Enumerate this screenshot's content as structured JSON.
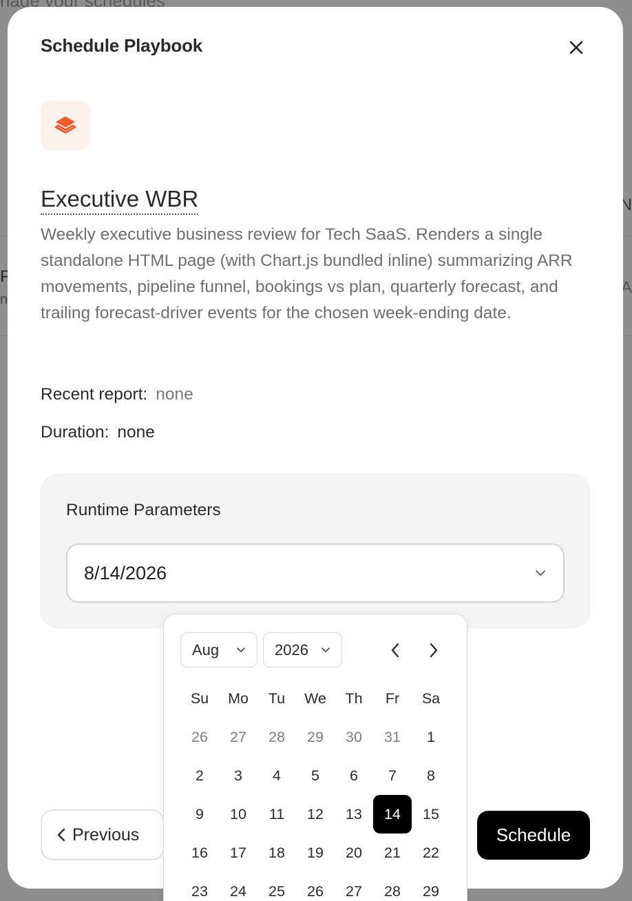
{
  "background": {
    "header_text": "nage your schedules",
    "left_glyphs": [
      "P",
      "n"
    ],
    "right_glyphs": [
      "N",
      "A"
    ]
  },
  "modal": {
    "title": "Schedule Playbook",
    "close_icon": "close-icon"
  },
  "playbook": {
    "icon": "layers-icon",
    "accent_color": "#f05a28",
    "name": "Executive WBR",
    "description": "Weekly executive business review for Tech SaaS. Renders a single standalone HTML page (with Chart.js bundled inline) summarizing ARR movements, pipeline funnel, bookings vs plan, quarterly forecast, and trailing forecast-driver events for the chosen week-ending date."
  },
  "meta": {
    "recent_report_label": "Recent report:",
    "recent_report_value": "none",
    "duration_label": "Duration:",
    "duration_value": "none"
  },
  "params": {
    "title": "Runtime Parameters",
    "date_value": "8/14/2026"
  },
  "calendar": {
    "month": "Aug",
    "year": "2026",
    "weekdays": [
      "Su",
      "Mo",
      "Tu",
      "We",
      "Th",
      "Fr",
      "Sa"
    ],
    "weeks": [
      [
        {
          "d": "26",
          "out": true
        },
        {
          "d": "27",
          "out": true
        },
        {
          "d": "28",
          "out": true
        },
        {
          "d": "29",
          "out": true
        },
        {
          "d": "30",
          "out": true
        },
        {
          "d": "31",
          "out": true
        },
        {
          "d": "1"
        }
      ],
      [
        {
          "d": "2"
        },
        {
          "d": "3"
        },
        {
          "d": "4"
        },
        {
          "d": "5"
        },
        {
          "d": "6"
        },
        {
          "d": "7"
        },
        {
          "d": "8"
        }
      ],
      [
        {
          "d": "9"
        },
        {
          "d": "10"
        },
        {
          "d": "11"
        },
        {
          "d": "12"
        },
        {
          "d": "13"
        },
        {
          "d": "14",
          "selected": true
        },
        {
          "d": "15"
        }
      ],
      [
        {
          "d": "16"
        },
        {
          "d": "17"
        },
        {
          "d": "18"
        },
        {
          "d": "19"
        },
        {
          "d": "20"
        },
        {
          "d": "21"
        },
        {
          "d": "22"
        }
      ],
      [
        {
          "d": "23"
        },
        {
          "d": "24"
        },
        {
          "d": "25"
        },
        {
          "d": "26"
        },
        {
          "d": "27"
        },
        {
          "d": "28"
        },
        {
          "d": "29"
        }
      ]
    ]
  },
  "footer": {
    "previous_label": "Previous",
    "schedule_label": "Schedule"
  }
}
